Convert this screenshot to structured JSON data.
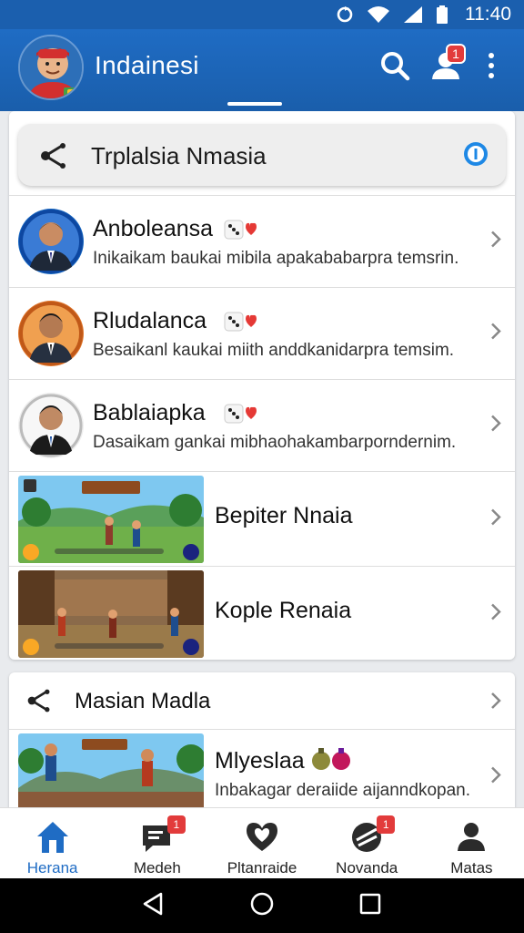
{
  "status_bar": {
    "time": "11:40",
    "icons": [
      "sync-icon",
      "wifi-icon",
      "signal-icon",
      "battery-icon"
    ]
  },
  "app_bar": {
    "title": "Indainesi",
    "actions": [
      "search-icon",
      "account-icon",
      "more-vert-icon"
    ],
    "account_badge": "1"
  },
  "search_bar": {
    "title": "Trplalsia Nmasia",
    "icons": [
      "share-icon",
      "info-icon"
    ]
  },
  "people": [
    {
      "name": "Anboleansa",
      "subtitle": "Inikaikam baukai mibila apakababarpra temsrin."
    },
    {
      "name": "Rludalanca",
      "subtitle": "Besaikanl kaukai miith anddkanidarpra temsim."
    },
    {
      "name": "Bablaiapka",
      "subtitle": "Dasaikam gankai mibhaohakambarporndernim."
    }
  ],
  "games": [
    {
      "name": "Bepiter Nnaia"
    },
    {
      "name": "Kople Renaia"
    }
  ],
  "section2": {
    "title": "Masian Madla",
    "item": {
      "name": "Mlyeslaa",
      "subtitle": "Inbakagar deraiide aijanndkopan."
    }
  },
  "bottom_nav": [
    {
      "label": "Herana",
      "icon": "home-icon",
      "active": true,
      "badge": ""
    },
    {
      "label": "Medeh",
      "icon": "message-icon",
      "active": false,
      "badge": "1"
    },
    {
      "label": "Pltanraide",
      "icon": "heart-icon",
      "active": false,
      "badge": ""
    },
    {
      "label": "Novanda",
      "icon": "ball-icon",
      "active": false,
      "badge": "1"
    },
    {
      "label": "Matas",
      "icon": "person-icon",
      "active": false,
      "badge": ""
    }
  ],
  "colors": {
    "brand": "#1f6cc4",
    "badge": "#e23b3b",
    "background": "#e9ebee"
  }
}
